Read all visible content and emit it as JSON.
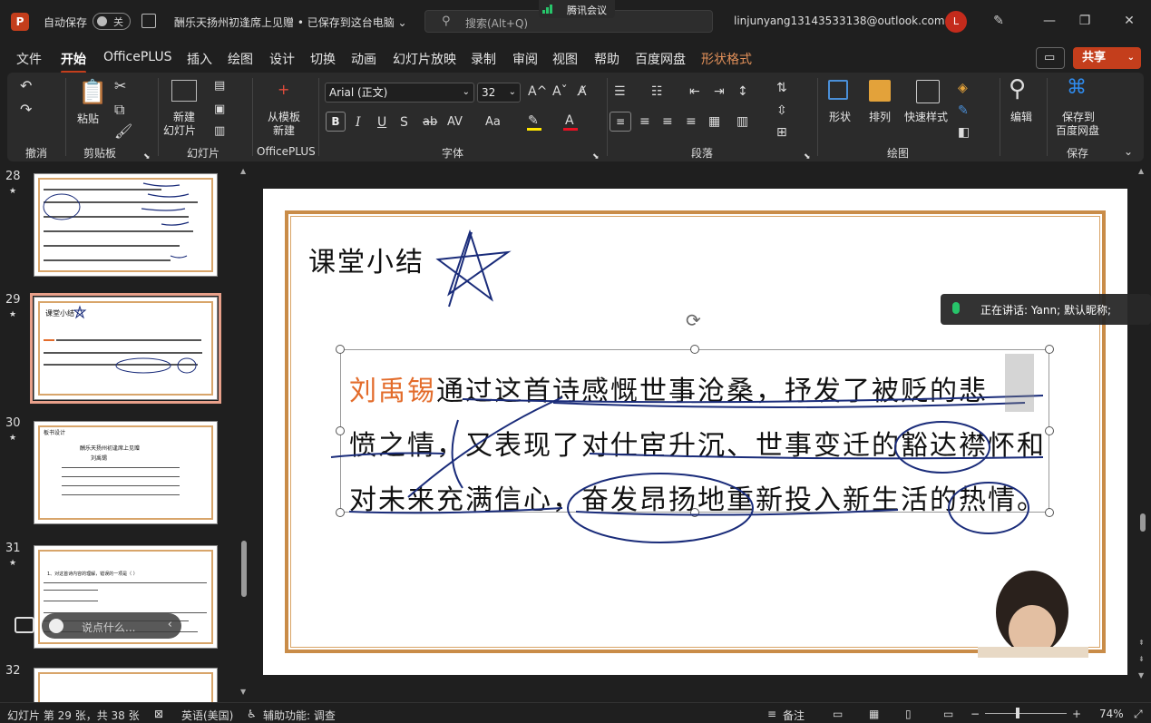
{
  "titlebar": {
    "app_letter": "P",
    "autosave_label": "自动保存",
    "autosave_state": "关",
    "doc_title": "酬乐天扬州初逢席上见赠 • 已保存到这台电脑",
    "search_placeholder": "搜索(Alt+Q)",
    "meeting_app": "腾讯会议",
    "account_email": "linjunyang13143533138@outlook.com",
    "avatar_letter": "L"
  },
  "menu": {
    "tabs": [
      "文件",
      "开始",
      "OfficePLUS",
      "插入",
      "绘图",
      "设计",
      "切换",
      "动画",
      "幻灯片放映",
      "录制",
      "审阅",
      "视图",
      "帮助",
      "百度网盘",
      "形状格式"
    ],
    "active_tab": "开始",
    "share_label": "共享"
  },
  "ribbon": {
    "groups": {
      "undo": "撤消",
      "clipboard": "剪贴板",
      "slides": "幻灯片",
      "officeplus": "OfficePLUS",
      "font": "字体",
      "paragraph": "段落",
      "drawing": "绘图",
      "save": "保存"
    },
    "paste_label": "粘贴",
    "new_slide_label_1": "新建",
    "new_slide_label_2": "幻灯片",
    "from_template_1": "从模板",
    "from_template_2": "新建",
    "font_name": "Arial (正文)",
    "font_size": "32",
    "shapes_label": "形状",
    "arrange_label": "排列",
    "quick_styles_label": "快速样式",
    "edit_label": "编辑",
    "save_baidu_1": "保存到",
    "save_baidu_2": "百度网盘",
    "colors": {
      "highlight": "#ffe600",
      "font_color": "#e81123",
      "accent": "#c43e1c"
    }
  },
  "slides_panel": {
    "items": [
      {
        "number": "28",
        "star": "★"
      },
      {
        "number": "29",
        "star": "★",
        "thumb_title": "课堂小结"
      },
      {
        "number": "30",
        "star": "★",
        "thumb_title": "板书设计",
        "thumb_subtitle": "酬乐天扬州初逢席上见赠",
        "thumb_author": "刘禹锡"
      },
      {
        "number": "31",
        "star": "★",
        "thumb_text": "1、对这首诗内容的理解，错误的一项是（ ）"
      },
      {
        "number": "32"
      }
    ]
  },
  "slide": {
    "title": "课堂小结",
    "author": "刘禹锡",
    "line1_rest": "通过这首诗感慨世事沧桑，抒发了被贬的悲",
    "line2": "愤之情，又表现了对仕宦升沉、世事变迁的豁达襟怀和",
    "line3": "对未来充满信心，奋发昂扬地重新投入新生活的热情。"
  },
  "overlays": {
    "speaking": "正在讲话: Yann; 默认昵称;",
    "chat_placeholder": "说点什么..."
  },
  "statusbar": {
    "slide_info": "幻灯片 第 29 张，共 38 张",
    "language": "英语(美国)",
    "accessibility": "辅助功能: 调查",
    "notes": "备注",
    "zoom": "74%"
  }
}
